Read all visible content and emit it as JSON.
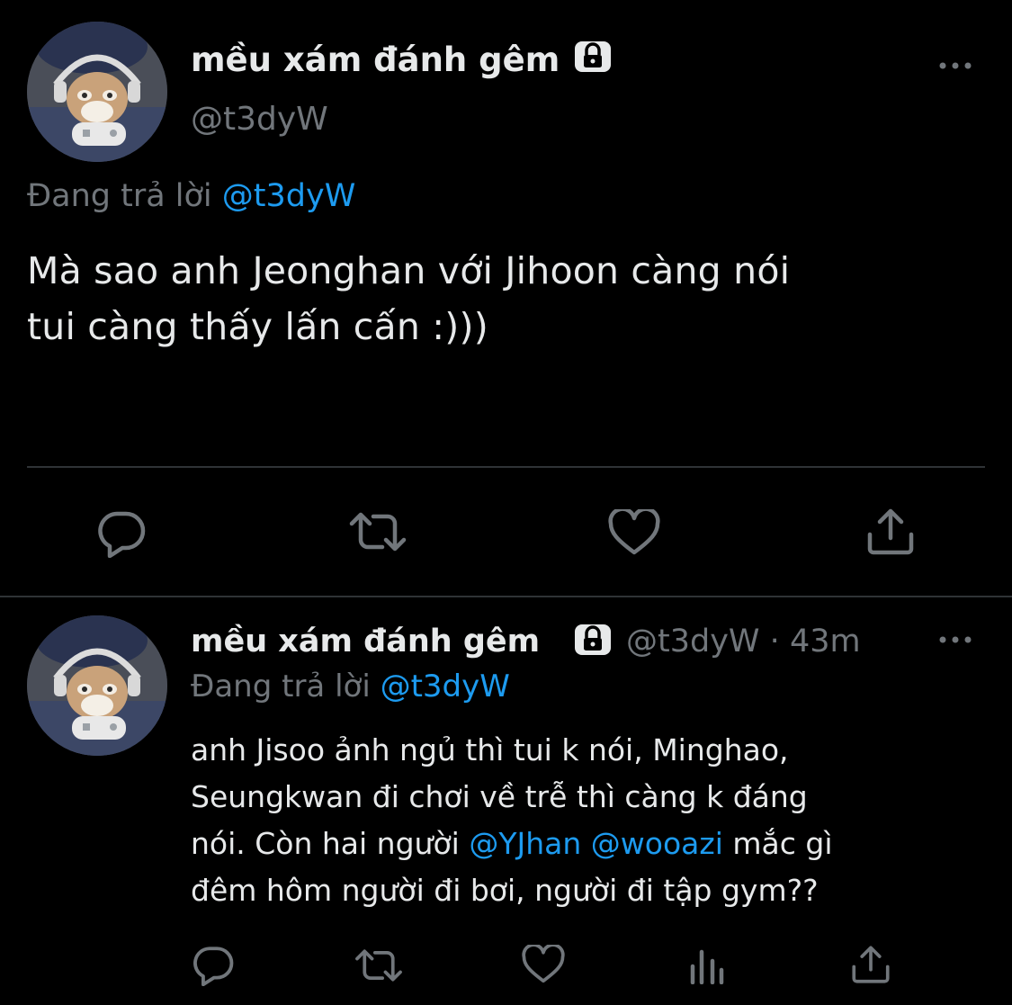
{
  "main_tweet": {
    "display_name": "mều xám đánh gêm",
    "handle": "@t3dyW",
    "replying_prefix": "Đang trả lời",
    "replying_to": "@t3dyW",
    "text_line1": "Mà sao anh Jeonghan với Jihoon càng nói",
    "text_line2": "tui càng thấy lấn cấn :)))"
  },
  "reply_tweet": {
    "display_name": "mều xám đánh gêm",
    "handle": "@t3dyW",
    "separator": "·",
    "time": "43m",
    "replying_prefix": "Đang trả lời",
    "replying_to": "@t3dyW",
    "line1": "anh Jisoo ảnh ngủ thì tui k nói, Minghao,",
    "line2": "Seungkwan đi chơi về trễ thì càng k đáng",
    "line3_a": "nói. Còn hai người",
    "mention1": "@YJhan",
    "mention2": "@wooazi",
    "line3_b": "mắc gì",
    "line4": "đêm hôm người đi bơi, người đi tập gym??"
  },
  "icons": {
    "lock": "lock-icon",
    "more": "more-icon",
    "reply": "reply-icon",
    "retweet": "retweet-icon",
    "like": "heart-icon",
    "share": "share-icon",
    "analytics": "analytics-icon"
  },
  "colors": {
    "background": "#000000",
    "text": "#e7e9ea",
    "secondary": "#71767b",
    "accent": "#1d9bf0",
    "divider": "#2f3336"
  }
}
